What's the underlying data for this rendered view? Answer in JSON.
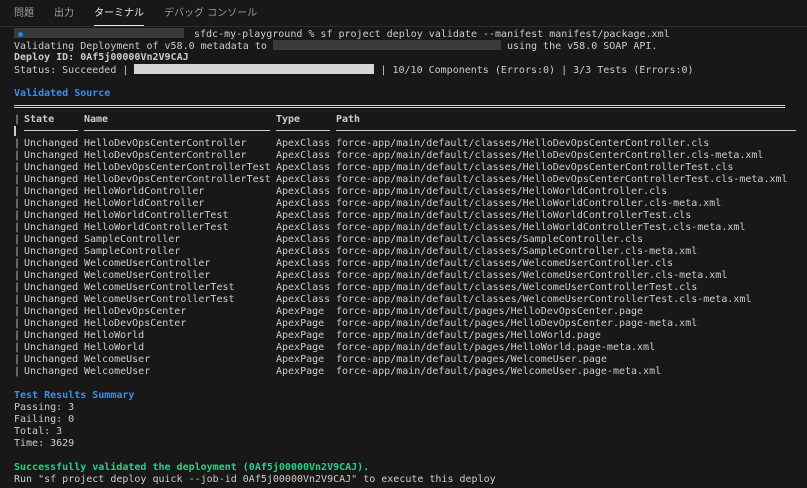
{
  "tabs": [
    {
      "label": "問題",
      "active": false
    },
    {
      "label": "出力",
      "active": false
    },
    {
      "label": "ターミナル",
      "active": true
    },
    {
      "label": "デバッグ コンソール",
      "active": false
    }
  ],
  "terminal": {
    "prompt": "sfdc-my-playground % sf project deploy validate --manifest manifest/package.xml",
    "validating_prefix": "Validating Deployment of v58.0 metadata to",
    "validating_suffix": "using the v58.0 SOAP API.",
    "deploy_id_label": "Deploy ID:",
    "deploy_id": "0Af5j00000Vn2V9CAJ",
    "status_prefix": "Status: Succeeded |",
    "status_suffix": "| 10/10 Components (Errors:0) | 3/3 Tests (Errors:0)",
    "validated_source_title": "Validated Source",
    "table_headers": {
      "state": "State",
      "name": "Name",
      "type": "Type",
      "path": "Path"
    },
    "rows": [
      {
        "state": "Unchanged",
        "name": "HelloDevOpsCenterController",
        "type": "ApexClass",
        "path": "force-app/main/default/classes/HelloDevOpsCenterController.cls"
      },
      {
        "state": "Unchanged",
        "name": "HelloDevOpsCenterController",
        "type": "ApexClass",
        "path": "force-app/main/default/classes/HelloDevOpsCenterController.cls-meta.xml"
      },
      {
        "state": "Unchanged",
        "name": "HelloDevOpsCenterControllerTest",
        "type": "ApexClass",
        "path": "force-app/main/default/classes/HelloDevOpsCenterControllerTest.cls"
      },
      {
        "state": "Unchanged",
        "name": "HelloDevOpsCenterControllerTest",
        "type": "ApexClass",
        "path": "force-app/main/default/classes/HelloDevOpsCenterControllerTest.cls-meta.xml"
      },
      {
        "state": "Unchanged",
        "name": "HelloWorldController",
        "type": "ApexClass",
        "path": "force-app/main/default/classes/HelloWorldController.cls"
      },
      {
        "state": "Unchanged",
        "name": "HelloWorldController",
        "type": "ApexClass",
        "path": "force-app/main/default/classes/HelloWorldController.cls-meta.xml"
      },
      {
        "state": "Unchanged",
        "name": "HelloWorldControllerTest",
        "type": "ApexClass",
        "path": "force-app/main/default/classes/HelloWorldControllerTest.cls"
      },
      {
        "state": "Unchanged",
        "name": "HelloWorldControllerTest",
        "type": "ApexClass",
        "path": "force-app/main/default/classes/HelloWorldControllerTest.cls-meta.xml"
      },
      {
        "state": "Unchanged",
        "name": "SampleController",
        "type": "ApexClass",
        "path": "force-app/main/default/classes/SampleController.cls"
      },
      {
        "state": "Unchanged",
        "name": "SampleController",
        "type": "ApexClass",
        "path": "force-app/main/default/classes/SampleController.cls-meta.xml"
      },
      {
        "state": "Unchanged",
        "name": "WelcomeUserController",
        "type": "ApexClass",
        "path": "force-app/main/default/classes/WelcomeUserController.cls"
      },
      {
        "state": "Unchanged",
        "name": "WelcomeUserController",
        "type": "ApexClass",
        "path": "force-app/main/default/classes/WelcomeUserController.cls-meta.xml"
      },
      {
        "state": "Unchanged",
        "name": "WelcomeUserControllerTest",
        "type": "ApexClass",
        "path": "force-app/main/default/classes/WelcomeUserControllerTest.cls"
      },
      {
        "state": "Unchanged",
        "name": "WelcomeUserControllerTest",
        "type": "ApexClass",
        "path": "force-app/main/default/classes/WelcomeUserControllerTest.cls-meta.xml"
      },
      {
        "state": "Unchanged",
        "name": "HelloDevOpsCenter",
        "type": "ApexPage",
        "path": "force-app/main/default/pages/HelloDevOpsCenter.page"
      },
      {
        "state": "Unchanged",
        "name": "HelloDevOpsCenter",
        "type": "ApexPage",
        "path": "force-app/main/default/pages/HelloDevOpsCenter.page-meta.xml"
      },
      {
        "state": "Unchanged",
        "name": "HelloWorld",
        "type": "ApexPage",
        "path": "force-app/main/default/pages/HelloWorld.page"
      },
      {
        "state": "Unchanged",
        "name": "HelloWorld",
        "type": "ApexPage",
        "path": "force-app/main/default/pages/HelloWorld.page-meta.xml"
      },
      {
        "state": "Unchanged",
        "name": "WelcomeUser",
        "type": "ApexPage",
        "path": "force-app/main/default/pages/WelcomeUser.page"
      },
      {
        "state": "Unchanged",
        "name": "WelcomeUser",
        "type": "ApexPage",
        "path": "force-app/main/default/pages/WelcomeUser.page-meta.xml"
      }
    ],
    "test_summary_title": "Test Results Summary",
    "passing": "Passing: 3",
    "failing": "Failing: 0",
    "total": "Total: 3",
    "time": "Time: 3629",
    "success_message": "Successfully validated the deployment (0Af5j00000Vn2V9CAJ).",
    "run_hint": "Run \"sf project deploy quick --job-id 0Af5j00000Vn2V9CAJ\" to execute this deploy"
  },
  "colors": {
    "background": "#181818",
    "text": "#cccccc",
    "heading_blue": "#3b8eea",
    "success_green": "#23d18b",
    "prompt_dot": "#2f80d0"
  }
}
